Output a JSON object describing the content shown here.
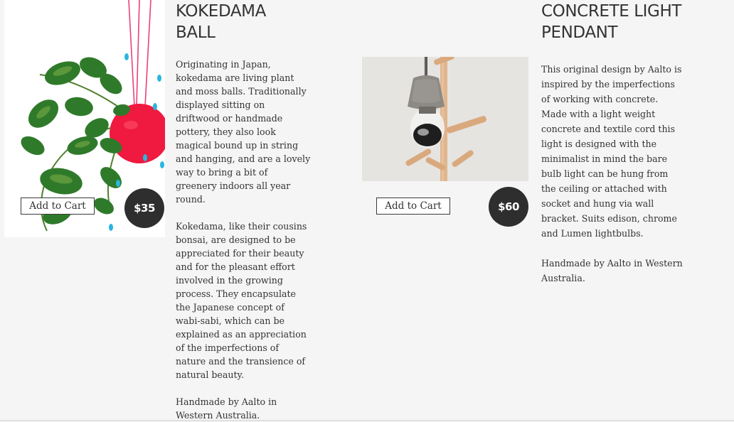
{
  "products": [
    {
      "title": "KOKEDAMA\nBALL",
      "price": "$35",
      "add_to_cart_label": "Add to Cart",
      "description": [
        "Originating in Japan, kokedama are living plant and moss balls. Traditionally displayed sitting on driftwood or handmade pottery, they also look magical bound up in string and hanging, and are a lovely way to bring a bit of greenery indoors all year round.",
        "Kokedama, like their cousins bonsai, are designed to be appreciated for their beauty and for the pleasant effort involved in the growing process. They encapsulate the Japanese concept of wabi-sabi, which can be explained as an appreciation of the imperfections of nature and the transience of natural beauty.",
        "Handmade by Aalto in Western Australia."
      ]
    },
    {
      "title": "CONCRETE LIGHT\nPENDANT",
      "price": "$60",
      "add_to_cart_label": "Add to Cart",
      "description": [
        "This original design by Aalto is inspired by the imperfections  of working with concrete. Made with a light weight concrete and textile cord this light is designed with the minimalist in mind the bare bulb light can be hung from the ceiling or attached with socket and hung via wall bracket. Suits edison, chrome and Lumen lightbulbs.",
        "Handmade by Aalto in Western Australia."
      ]
    }
  ],
  "colors": {
    "background": "#f5f5f5",
    "text": "#333333",
    "price_badge": "#2e2e2e",
    "kokedama_ball": "#f0193f",
    "leaf": "#2f7a2a",
    "water_drop": "#29b6e0"
  }
}
